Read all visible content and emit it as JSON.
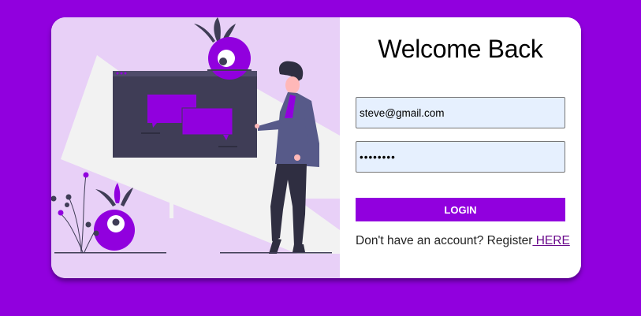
{
  "colors": {
    "page_background": "#9100de",
    "accent": "#9100de",
    "illustration_background": "#e8d0f7",
    "input_background": "#e6f0fe",
    "link": "#6a0a8c"
  },
  "illustration": {
    "description_icon": "person-presenting-chat-board-illustration"
  },
  "form": {
    "title": "Welcome Back",
    "email": {
      "value": "steve@gmail.com",
      "placeholder": ""
    },
    "password": {
      "value": "pwpwpwpw",
      "placeholder": ""
    },
    "login_label": "LOGIN",
    "register_text": "Don't have an account? Register",
    "register_link": " HERE"
  }
}
